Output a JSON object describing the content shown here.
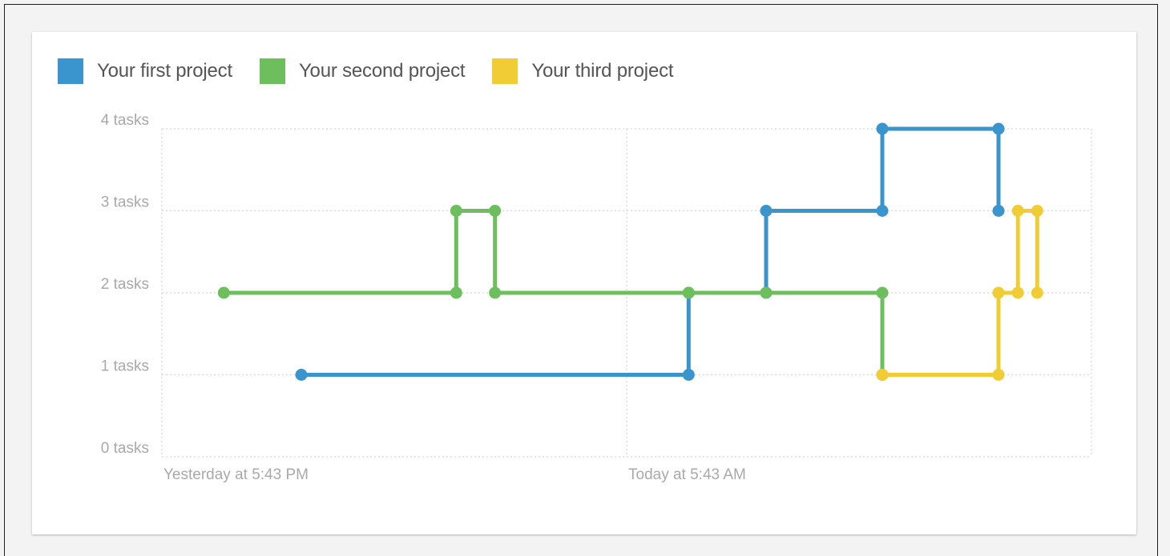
{
  "colors": {
    "first": "#3a95cf",
    "second": "#6cbf5c",
    "third": "#f1cd35",
    "grid": "#d6d6d6",
    "tick_text": "#a9a9a9",
    "legend_text": "#555555"
  },
  "legend": {
    "placement": "top-left",
    "items": [
      {
        "label": "Your first project",
        "color": "#3a95cf"
      },
      {
        "label": "Your second project",
        "color": "#6cbf5c"
      },
      {
        "label": "Your third project",
        "color": "#f1cd35"
      }
    ]
  },
  "chart_data": {
    "type": "line",
    "step": true,
    "grid": true,
    "x_axis": {
      "kind": "time",
      "ticks": [
        {
          "label": "Yesterday at 5:43 PM",
          "hours": 0
        },
        {
          "label": "Today at 5:43 AM",
          "hours": 12
        }
      ],
      "range_hours": [
        0,
        24
      ]
    },
    "y_axis": {
      "ticks": [
        "0 tasks",
        "1 tasks",
        "2 tasks",
        "3 tasks",
        "4 tasks"
      ],
      "ylim": [
        0,
        4
      ]
    },
    "series": [
      {
        "name": "Your first project",
        "color": "#3a95cf",
        "points": [
          {
            "hours": 3.6,
            "y": 1
          },
          {
            "hours": 13.6,
            "y": 1
          },
          {
            "hours": 13.6,
            "y": 2
          },
          {
            "hours": 15.6,
            "y": 2
          },
          {
            "hours": 15.6,
            "y": 3
          },
          {
            "hours": 18.6,
            "y": 3
          },
          {
            "hours": 18.6,
            "y": 4
          },
          {
            "hours": 21.6,
            "y": 4
          },
          {
            "hours": 21.6,
            "y": 3
          }
        ]
      },
      {
        "name": "Your second project",
        "color": "#6cbf5c",
        "points": [
          {
            "hours": 1.6,
            "y": 2
          },
          {
            "hours": 7.6,
            "y": 2
          },
          {
            "hours": 7.6,
            "y": 3
          },
          {
            "hours": 8.6,
            "y": 3
          },
          {
            "hours": 8.6,
            "y": 2
          },
          {
            "hours": 13.6,
            "y": 2
          },
          {
            "hours": 15.6,
            "y": 2
          },
          {
            "hours": 18.6,
            "y": 2
          },
          {
            "hours": 18.6,
            "y": 1
          }
        ]
      },
      {
        "name": "Your third project",
        "color": "#f1cd35",
        "points": [
          {
            "hours": 18.6,
            "y": 1
          },
          {
            "hours": 21.6,
            "y": 1
          },
          {
            "hours": 21.6,
            "y": 2
          },
          {
            "hours": 22.1,
            "y": 2
          },
          {
            "hours": 22.1,
            "y": 3
          },
          {
            "hours": 22.6,
            "y": 3
          },
          {
            "hours": 22.6,
            "y": 2
          }
        ]
      }
    ]
  }
}
